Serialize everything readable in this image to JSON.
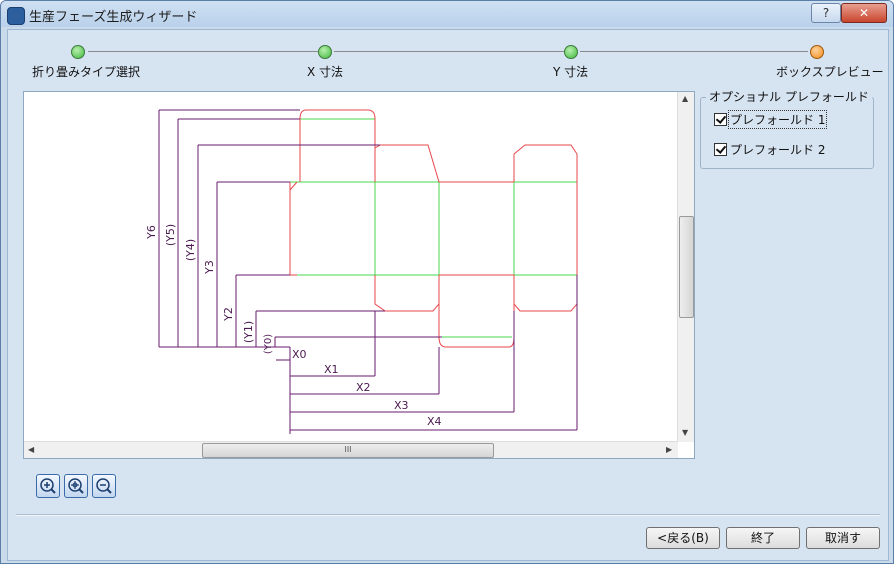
{
  "window": {
    "title": "生産フェーズ生成ウィザード",
    "help_label": "?",
    "close_label": "✕"
  },
  "steps": [
    {
      "label": "折り畳みタイプ選択"
    },
    {
      "label": "X 寸法"
    },
    {
      "label": "Y 寸法"
    },
    {
      "label": "ボックスプレビュー"
    }
  ],
  "preview": {
    "x_labels": [
      "X0",
      "X1",
      "X2",
      "X3",
      "X4"
    ],
    "y_labels": [
      "Y6",
      "(Y5)",
      "(Y4)",
      "Y3",
      "Y2",
      "(Y1)",
      "(Y0)"
    ],
    "colors": {
      "cut": "#e8474b",
      "fold": "#49d84c",
      "dim": "#6a1b6e"
    }
  },
  "optional_prefold": {
    "title": "オプショナル プレフォールド",
    "items": [
      {
        "label": "プレフォールド 1",
        "checked": true
      },
      {
        "label": "プレフォールド 2",
        "checked": true
      }
    ]
  },
  "buttons": {
    "back": "<戻る(B)",
    "finish": "終了",
    "cancel": "取消す"
  },
  "scroll_grip": "III"
}
